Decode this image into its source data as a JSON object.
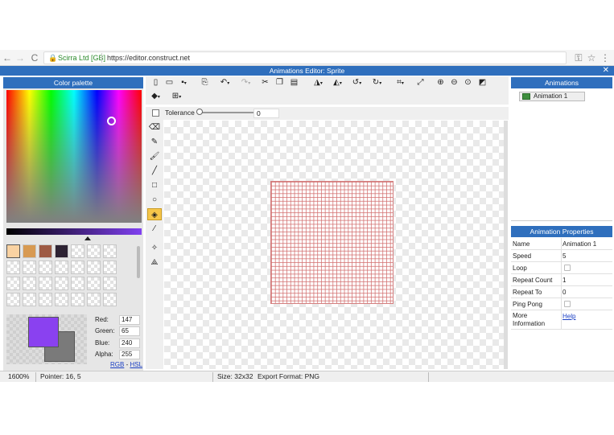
{
  "browser": {
    "site_label": "Scirra Ltd [GB]",
    "url": "https://editor.construct.net",
    "back_icon": "←",
    "forward_icon": "→",
    "reload_icon": "C",
    "key_icon": "⚿",
    "star_icon": "☆",
    "menu_icon": "⋮"
  },
  "window": {
    "title": "Animations Editor: Sprite",
    "close": "✕"
  },
  "color_palette": {
    "title": "Color palette",
    "swatches": [
      "#f9d2a2",
      "#d89a52",
      "#9e5a44",
      "#2d2233"
    ],
    "primary_color": "#8a41f0",
    "secondary_color": "#7a7a7a",
    "red_label": "Red:",
    "red": "147",
    "green_label": "Green:",
    "green": "65",
    "blue_label": "Blue:",
    "blue": "240",
    "alpha_label": "Alpha:",
    "alpha": "255",
    "mode_rgb": "RGB",
    "mode_sep": " - ",
    "mode_hsl": "HSL"
  },
  "toolbar": {
    "tolerance_label": "Tolerance",
    "tolerance_value": "0"
  },
  "animations": {
    "title": "Animations",
    "items": [
      {
        "label": "Animation 1"
      }
    ]
  },
  "properties": {
    "title": "Animation Properties",
    "rows": [
      {
        "label": "Name",
        "value": "Animation 1"
      },
      {
        "label": "Speed",
        "value": "5"
      },
      {
        "label": "Loop",
        "value": ""
      },
      {
        "label": "Repeat Count",
        "value": "1"
      },
      {
        "label": "Repeat To",
        "value": "0"
      },
      {
        "label": "Ping Pong",
        "value": ""
      },
      {
        "label": "More Information",
        "value": "Help"
      }
    ]
  },
  "status": {
    "zoom": "1600%",
    "pointer": "Pointer: 16, 5",
    "size": "Size: 32x32",
    "export": "Export Format: PNG"
  }
}
